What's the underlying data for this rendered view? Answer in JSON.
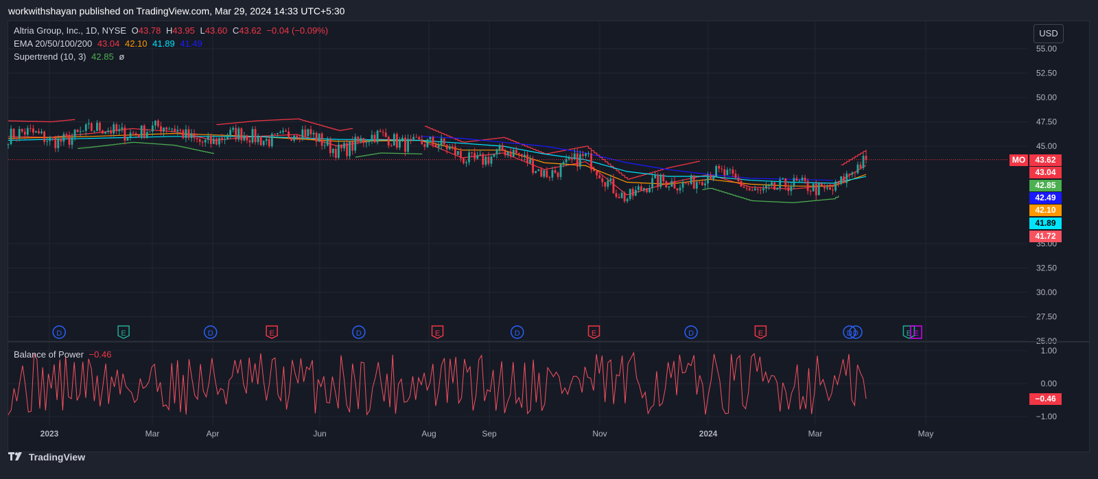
{
  "header": {
    "publisher": "workwithshayan published on TradingView.com, Mar 29, 2024 14:33 UTC+5:30"
  },
  "legend": {
    "symbol": "Altria Group, Inc., 1D, NYSE",
    "open_label": "O",
    "open": "43.78",
    "high_label": "H",
    "high": "43.95",
    "low_label": "L",
    "low": "43.60",
    "close_label": "C",
    "close": "43.62",
    "change": "−0.04 (−0.09%)",
    "ema_name": "EMA 20/50/100/200",
    "ema20": "43.04",
    "ema50": "42.10",
    "ema100": "41.89",
    "ema200": "41.49",
    "supertrend_name": "Supertrend (10, 3)",
    "supertrend": "42.85",
    "supertrend_extra": "ø"
  },
  "bop_legend": {
    "name": "Balance of Power",
    "value": "−0.46"
  },
  "currency_button": "USD",
  "symbol_tag": "MO",
  "price_tags": [
    {
      "value": "43.62",
      "bg": "#f23645",
      "fg": "#ffffff"
    },
    {
      "value": "43.04",
      "bg": "#f23645",
      "fg": "#ffffff"
    },
    {
      "value": "42.85",
      "bg": "#4caf50",
      "fg": "#ffffff"
    },
    {
      "value": "42.49",
      "bg": "#1a1aff",
      "fg": "#ffffff"
    },
    {
      "value": "42.10",
      "bg": "#ff9800",
      "fg": "#ffffff"
    },
    {
      "value": "41.89",
      "bg": "#00e5ff",
      "fg": "#000000"
    },
    {
      "value": "41.72",
      "bg": "#f7525f",
      "fg": "#ffffff"
    }
  ],
  "bop_tag": "−0.46",
  "footer": {
    "brand": "TradingView",
    "logo_icon": "tradingview-logo-icon"
  },
  "colors": {
    "up": "#26a69a",
    "down": "#f23645",
    "ema20": "#f23645",
    "ema50": "#ff9800",
    "ema100": "#00e5ff",
    "ema200": "#1a1aff",
    "supertrend_up": "#4caf50",
    "supertrend_down": "#f23645",
    "bop": "#f7525f",
    "grid": "#232733",
    "text": "#b2b5be"
  },
  "chart_data": {
    "type": "candlestick",
    "price_axis": {
      "ticks": [
        "55.00",
        "52.50",
        "50.00",
        "47.50",
        "45.00",
        "35.00",
        "32.50",
        "30.00",
        "27.50",
        "25.00"
      ],
      "ylim": [
        25,
        56
      ]
    },
    "time_axis": {
      "ticks": [
        "2023",
        "Mar",
        "Apr",
        "Jun",
        "Aug",
        "Sep",
        "Nov",
        "2024",
        "Mar",
        "May"
      ]
    },
    "last_price": 43.62,
    "ema": {
      "ema20": {
        "points": [
          [
            0,
            46.0
          ],
          [
            0.05,
            45.9
          ],
          [
            0.1,
            46.3
          ],
          [
            0.15,
            46.8
          ],
          [
            0.2,
            46.5
          ],
          [
            0.25,
            45.6
          ],
          [
            0.3,
            46.0
          ],
          [
            0.35,
            46.2
          ],
          [
            0.4,
            45.0
          ],
          [
            0.45,
            45.7
          ],
          [
            0.5,
            45.6
          ],
          [
            0.55,
            43.8
          ],
          [
            0.6,
            44.3
          ],
          [
            0.65,
            42.6
          ],
          [
            0.7,
            43.4
          ],
          [
            0.75,
            40.0
          ],
          [
            0.8,
            41.2
          ],
          [
            0.85,
            42.1
          ],
          [
            0.9,
            40.8
          ],
          [
            0.95,
            40.6
          ],
          [
            1.0,
            41.0
          ],
          [
            1.04,
            43.04
          ]
        ]
      },
      "ema50": {
        "points": [
          [
            0,
            45.8
          ],
          [
            0.1,
            46.0
          ],
          [
            0.2,
            46.3
          ],
          [
            0.3,
            46.0
          ],
          [
            0.4,
            45.5
          ],
          [
            0.5,
            45.6
          ],
          [
            0.55,
            44.6
          ],
          [
            0.6,
            44.6
          ],
          [
            0.65,
            43.3
          ],
          [
            0.7,
            43.0
          ],
          [
            0.75,
            41.3
          ],
          [
            0.8,
            41.1
          ],
          [
            0.85,
            41.6
          ],
          [
            0.9,
            41.1
          ],
          [
            0.95,
            40.9
          ],
          [
            1.0,
            40.9
          ],
          [
            1.04,
            42.1
          ]
        ]
      },
      "ema100": {
        "points": [
          [
            0,
            45.6
          ],
          [
            0.1,
            45.8
          ],
          [
            0.2,
            46.0
          ],
          [
            0.3,
            46.0
          ],
          [
            0.4,
            45.7
          ],
          [
            0.5,
            45.6
          ],
          [
            0.6,
            45.0
          ],
          [
            0.65,
            44.2
          ],
          [
            0.7,
            43.6
          ],
          [
            0.75,
            42.4
          ],
          [
            0.8,
            41.9
          ],
          [
            0.85,
            41.9
          ],
          [
            0.9,
            41.5
          ],
          [
            0.95,
            41.3
          ],
          [
            1.0,
            41.2
          ],
          [
            1.04,
            41.89
          ]
        ]
      },
      "ema200": {
        "points": [
          [
            0.5,
            46.0
          ],
          [
            0.55,
            45.8
          ],
          [
            0.6,
            45.4
          ],
          [
            0.65,
            45.0
          ],
          [
            0.7,
            44.3
          ],
          [
            0.75,
            43.3
          ],
          [
            0.8,
            42.6
          ],
          [
            0.85,
            42.1
          ],
          [
            0.9,
            41.7
          ],
          [
            0.95,
            41.6
          ],
          [
            1.0,
            41.49
          ]
        ]
      }
    },
    "bop": {
      "ylim": [
        -1.1,
        1.1
      ],
      "ticks": [
        "1.00",
        "0.00",
        "−1.00"
      ],
      "last": -0.46
    },
    "events": [
      {
        "label": "D",
        "kind": "dividend",
        "pos": 0.027
      },
      {
        "label": "E",
        "kind": "earnings",
        "pos": 0.09
      },
      {
        "label": "D",
        "kind": "dividend",
        "pos": 0.175
      },
      {
        "label": "E",
        "kind": "earnings",
        "pos": 0.235
      },
      {
        "label": "D",
        "kind": "dividend",
        "pos": 0.32
      },
      {
        "label": "E",
        "kind": "earnings",
        "pos": 0.397
      },
      {
        "label": "D",
        "kind": "dividend",
        "pos": 0.475
      },
      {
        "label": "E",
        "kind": "earnings",
        "pos": 0.55
      },
      {
        "label": "D",
        "kind": "dividend",
        "pos": 0.645
      },
      {
        "label": "E",
        "kind": "earnings",
        "pos": 0.713
      },
      {
        "label": "D",
        "kind": "dividend",
        "pos": 0.8
      },
      {
        "label": "E",
        "kind": "earnings",
        "pos": 0.858
      }
    ]
  }
}
